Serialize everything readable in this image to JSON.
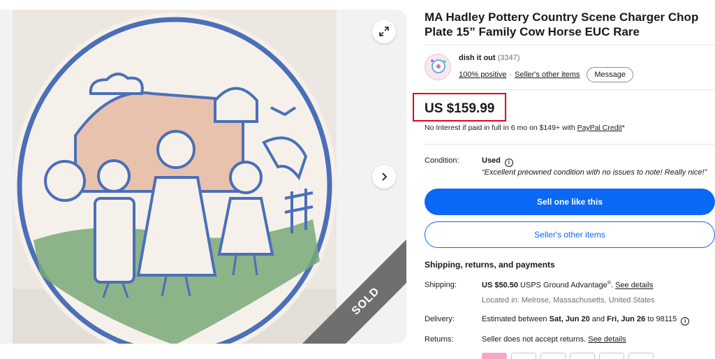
{
  "gallery": {
    "expand_icon": "expand-icon",
    "next_icon": "chevron-right-icon",
    "sold_label": "SOLD"
  },
  "listing": {
    "title": "MA Hadley Pottery Country Scene Charger Chop Plate 15” Family Cow Horse EUC Rare"
  },
  "seller": {
    "name": "dish it out",
    "feedback_count": "(3347)",
    "positive": "100% positive",
    "separator": "·",
    "other_items": "Seller's other items",
    "message_label": "Message"
  },
  "price": {
    "value": "US $159.99",
    "financing_text": "No Interest if paid in full in 6 mo on $149+ with ",
    "financing_link": "PayPal Credit",
    "financing_suffix": "*"
  },
  "condition": {
    "label": "Condition:",
    "value": "Used",
    "quote": "“Excellent preowned condition with no issues to note! Really nice!”"
  },
  "actions": {
    "sell_one": "Sell one like this",
    "sellers_other": "Seller's other items"
  },
  "shipping_section": {
    "title": "Shipping, returns, and payments",
    "shipping_label": "Shipping:",
    "shipping_price": "US $50.50",
    "shipping_service": " USPS Ground Advantage",
    "shipping_reg": "®",
    "shipping_sep": ". ",
    "see_details": "See details",
    "location": "Located in: Melrose, Massachusetts, United States",
    "delivery_label": "Delivery:",
    "delivery_prefix": "Estimated between ",
    "delivery_start": "Sat, Jun 20",
    "delivery_and": " and ",
    "delivery_end": "Fri, Jun 26",
    "delivery_suffix": " to 98115",
    "returns_label": "Returns:",
    "returns_text": "Seller does not accept returns. ",
    "returns_link": "See details"
  },
  "colors": {
    "primary_blue": "#0968f6",
    "price_highlight": "#e0001b",
    "sold_ribbon": "#6f6f6f"
  }
}
